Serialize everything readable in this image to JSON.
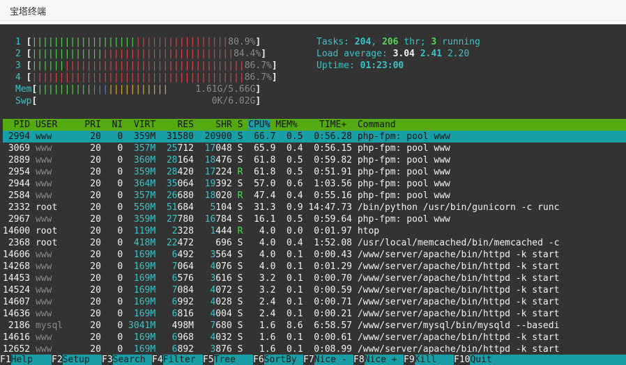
{
  "window": {
    "title": "宝塔终端"
  },
  "cpu_meters": [
    {
      "label": "1",
      "percent_text": "80.9%",
      "green_bars": 19,
      "red_bars": 17
    },
    {
      "label": "2",
      "percent_text": "84.4%",
      "green_bars": 13,
      "red_bars": 24
    },
    {
      "label": "3",
      "percent_text": "86.7%",
      "green_bars": 6,
      "red_bars": 33
    },
    {
      "label": "4",
      "percent_text": "86.7%",
      "green_bars": 0,
      "red_bars": 39
    }
  ],
  "mem": {
    "label": "Mem",
    "value_text": "1.61G/5.66G",
    "green_bars": 10,
    "blue_bars": 3,
    "yellow_bars": 11
  },
  "swp": {
    "label": "Swp",
    "value_text": "0K/6.02G"
  },
  "tasks": {
    "label": "Tasks:",
    "total": "204",
    "threads": "206",
    "thr_label": "thr;",
    "running": "3",
    "running_label": "running"
  },
  "load": {
    "label": "Load average:",
    "one": "3.04",
    "five": "2.41",
    "fifteen": "2.20"
  },
  "uptime": {
    "label": "Uptime:",
    "value": "01:23:00"
  },
  "columns": {
    "pid": "PID",
    "user": "USER",
    "pri": "PRI",
    "ni": "NI",
    "virt": "VIRT",
    "res": "RES",
    "shr": "SHR",
    "s": "S",
    "cpu": "CPU%",
    "mem": "MEM%",
    "time": "TIME+",
    "command": "Command"
  },
  "processes": [
    {
      "pid": "2994",
      "user": "www",
      "pri": "20",
      "ni": "0",
      "virt": "359M",
      "res": "31580",
      "shr": "20900",
      "s": "S",
      "cpu": "66.7",
      "mem": "0.5",
      "time": "0:56.28",
      "command": "php-fpm: pool www"
    },
    {
      "pid": "3069",
      "user": "www",
      "pri": "20",
      "ni": "0",
      "virt": "357M",
      "res": "25712",
      "shr": "17048",
      "s": "S",
      "cpu": "65.9",
      "mem": "0.4",
      "time": "0:56.15",
      "command": "php-fpm: pool www"
    },
    {
      "pid": "2889",
      "user": "www",
      "pri": "20",
      "ni": "0",
      "virt": "360M",
      "res": "28164",
      "shr": "18476",
      "s": "S",
      "cpu": "61.8",
      "mem": "0.5",
      "time": "0:59.82",
      "command": "php-fpm: pool www"
    },
    {
      "pid": "2954",
      "user": "www",
      "pri": "20",
      "ni": "0",
      "virt": "359M",
      "res": "28420",
      "shr": "17224",
      "s": "R",
      "cpu": "61.8",
      "mem": "0.5",
      "time": "0:51.91",
      "command": "php-fpm: pool www"
    },
    {
      "pid": "2944",
      "user": "www",
      "pri": "20",
      "ni": "0",
      "virt": "364M",
      "res": "35064",
      "shr": "19392",
      "s": "S",
      "cpu": "57.0",
      "mem": "0.6",
      "time": "1:03.56",
      "command": "php-fpm: pool www"
    },
    {
      "pid": "2584",
      "user": "www",
      "pri": "20",
      "ni": "0",
      "virt": "357M",
      "res": "26680",
      "shr": "18020",
      "s": "R",
      "cpu": "47.4",
      "mem": "0.4",
      "time": "0:55.16",
      "command": "php-fpm: pool www"
    },
    {
      "pid": "2332",
      "user": "root",
      "pri": "20",
      "ni": "0",
      "virt": "550M",
      "res": "51684",
      "shr": "5104",
      "s": "S",
      "cpu": "31.3",
      "mem": "0.9",
      "time": "14:47.73",
      "command": "/bin/python /usr/bin/gunicorn -c runc"
    },
    {
      "pid": "2967",
      "user": "www",
      "pri": "20",
      "ni": "0",
      "virt": "359M",
      "res": "27780",
      "shr": "16784",
      "s": "S",
      "cpu": "16.1",
      "mem": "0.5",
      "time": "0:59.64",
      "command": "php-fpm: pool www"
    },
    {
      "pid": "14600",
      "user": "root",
      "pri": "20",
      "ni": "0",
      "virt": "119M",
      "res": "2328",
      "shr": "1444",
      "s": "R",
      "cpu": "4.0",
      "mem": "0.0",
      "time": "0:01.97",
      "command": "htop"
    },
    {
      "pid": "2368",
      "user": "root",
      "pri": "20",
      "ni": "0",
      "virt": "418M",
      "res": "22472",
      "shr": "696",
      "s": "S",
      "cpu": "4.0",
      "mem": "0.4",
      "time": "1:52.08",
      "command": "/usr/local/memcached/bin/memcached -c"
    },
    {
      "pid": "14606",
      "user": "www",
      "pri": "20",
      "ni": "0",
      "virt": "169M",
      "res": "6492",
      "shr": "3564",
      "s": "S",
      "cpu": "4.0",
      "mem": "0.1",
      "time": "0:00.43",
      "command": "/www/server/apache/bin/httpd -k start"
    },
    {
      "pid": "14268",
      "user": "www",
      "pri": "20",
      "ni": "0",
      "virt": "169M",
      "res": "7064",
      "shr": "4076",
      "s": "S",
      "cpu": "4.0",
      "mem": "0.1",
      "time": "0:01.29",
      "command": "/www/server/apache/bin/httpd -k start"
    },
    {
      "pid": "14453",
      "user": "www",
      "pri": "20",
      "ni": "0",
      "virt": "169M",
      "res": "6576",
      "shr": "3616",
      "s": "S",
      "cpu": "3.2",
      "mem": "0.1",
      "time": "0:00.70",
      "command": "/www/server/apache/bin/httpd -k start"
    },
    {
      "pid": "14524",
      "user": "www",
      "pri": "20",
      "ni": "0",
      "virt": "169M",
      "res": "7084",
      "shr": "4072",
      "s": "S",
      "cpu": "3.2",
      "mem": "0.1",
      "time": "0:00.59",
      "command": "/www/server/apache/bin/httpd -k start"
    },
    {
      "pid": "14607",
      "user": "www",
      "pri": "20",
      "ni": "0",
      "virt": "169M",
      "res": "6992",
      "shr": "4028",
      "s": "S",
      "cpu": "2.4",
      "mem": "0.1",
      "time": "0:00.71",
      "command": "/www/server/apache/bin/httpd -k start"
    },
    {
      "pid": "14636",
      "user": "www",
      "pri": "20",
      "ni": "0",
      "virt": "169M",
      "res": "6816",
      "shr": "4004",
      "s": "S",
      "cpu": "2.4",
      "mem": "0.1",
      "time": "0:00.21",
      "command": "/www/server/apache/bin/httpd -k start"
    },
    {
      "pid": "2186",
      "user": "mysql",
      "pri": "20",
      "ni": "0",
      "virt": "3041M",
      "res": "498M",
      "shr": "7680",
      "s": "S",
      "cpu": "1.6",
      "mem": "8.6",
      "time": "6:58.57",
      "command": "/www/server/mysql/bin/mysqld --basedi"
    },
    {
      "pid": "14616",
      "user": "www",
      "pri": "20",
      "ni": "0",
      "virt": "169M",
      "res": "6968",
      "shr": "4032",
      "s": "S",
      "cpu": "1.6",
      "mem": "0.1",
      "time": "0:00.61",
      "command": "/www/server/apache/bin/httpd -k start"
    },
    {
      "pid": "12652",
      "user": "www",
      "pri": "20",
      "ni": "0",
      "virt": "169M",
      "res": "6892",
      "shr": "3876",
      "s": "S",
      "cpu": "1.6",
      "mem": "0.1",
      "time": "0:08.99",
      "command": "/www/server/apache/bin/httpd -k start"
    }
  ],
  "function_keys": [
    {
      "key": "F1",
      "label": "Help"
    },
    {
      "key": "F2",
      "label": "Setup"
    },
    {
      "key": "F3",
      "label": "Search"
    },
    {
      "key": "F4",
      "label": "Filter"
    },
    {
      "key": "F5",
      "label": "Tree"
    },
    {
      "key": "F6",
      "label": "SortBy"
    },
    {
      "key": "F7",
      "label": "Nice -"
    },
    {
      "key": "F8",
      "label": "Nice +"
    },
    {
      "key": "F9",
      "label": "Kill"
    },
    {
      "key": "F10",
      "label": "Quit"
    }
  ],
  "colors": {
    "header_bg": "#55aa12",
    "selected_bg": "#1a9ea6",
    "terminal_bg": "#333333",
    "cyan": "#39c4c8",
    "red": "#e0474c",
    "green": "#56d656"
  }
}
